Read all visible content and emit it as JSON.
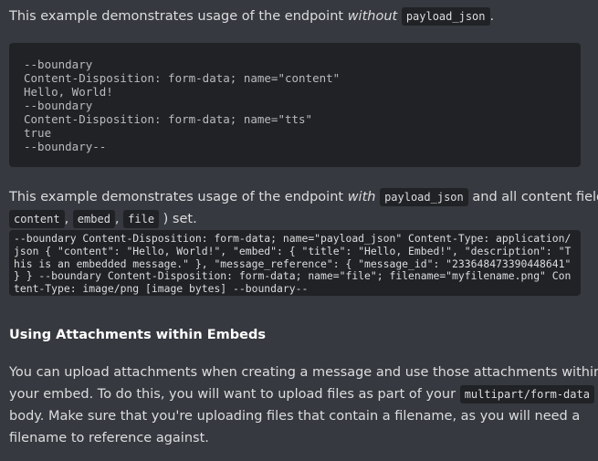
{
  "intro1": {
    "prefix": "This example demonstrates usage of the endpoint ",
    "em": "without",
    "code": "payload_json",
    "suffix": "."
  },
  "block1": {
    "lines": [
      "--boundary",
      "Content-Disposition: form-data; name=\"content\"",
      "Hello, World!",
      "--boundary",
      "Content-Disposition: form-data; name=\"tts\"",
      "true",
      "--boundary--"
    ]
  },
  "intro2": {
    "prefix": "This example demonstrates usage of the endpoint ",
    "em": "with",
    "code": "payload_json",
    "middle": " and all content fields (",
    "field1": "content",
    "sep1": ",",
    "field2": "embed",
    "sep2": ",",
    "field3": "file",
    "suffix": ") set."
  },
  "block2": {
    "text": "--boundary Content-Disposition: form-data; name=\"payload_json\" Content-Type: application/json { \"content\": \"Hello, World!\", \"embed\": { \"title\": \"Hello, Embed!\", \"description\": \"This is an embedded message.\" }, \"message_reference\": { \"message_id\": \"233648473390448641\" } } --boundary Content-Disposition: form-data; name=\"file\"; filename=\"myfilename.png\" Content-Type: image/png [image bytes] --boundary--"
  },
  "section": {
    "heading": "Using Attachments within Embeds",
    "line1": "You can upload attachments when creating a message and use those attachments within",
    "line2_prefix": "your embed. To do this, you will want to upload files as part of your ",
    "line2_code": "multipart/form-data",
    "line3": "body. Make sure that you're uploading files that contain a filename, as you will need a",
    "line4": "filename to reference against."
  }
}
